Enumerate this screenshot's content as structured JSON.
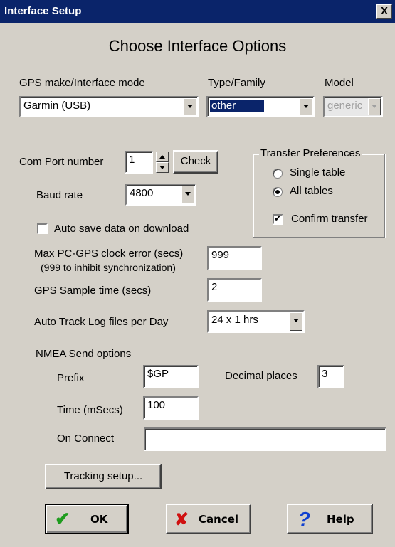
{
  "window": {
    "title": "Interface Setup",
    "close_glyph": "X"
  },
  "heading": "Choose Interface Options",
  "gps_make": {
    "label": "GPS make/Interface mode",
    "value": "Garmin (USB)"
  },
  "type_family": {
    "label": "Type/Family",
    "value": "other"
  },
  "model": {
    "label": "Model",
    "value": "generic"
  },
  "com_port": {
    "label": "Com Port number",
    "value": "1",
    "check_label": "Check"
  },
  "baud": {
    "label": "Baud rate",
    "value": "4800"
  },
  "auto_save": {
    "label": "Auto save data on download",
    "checked": false
  },
  "transfer": {
    "title": "Transfer Preferences",
    "single_label": "Single table",
    "all_label": "All tables",
    "selected": "All tables",
    "confirm_label": "Confirm transfer",
    "confirm_checked": true
  },
  "clock_error": {
    "label1": "Max PC-GPS clock error (secs)",
    "label2": "(999 to inhibit synchronization)",
    "value": "999"
  },
  "sample_time": {
    "label": "GPS Sample time (secs)",
    "value": "2"
  },
  "track_log": {
    "label": "Auto Track Log files per Day",
    "value": "24 x 1 hrs"
  },
  "nmea": {
    "title": "NMEA  Send options",
    "prefix_label": "Prefix",
    "prefix_value": "$GP",
    "decimal_label": "Decimal places",
    "decimal_value": "3",
    "time_label": "Time (mSecs)",
    "time_value": "100",
    "connect_label": "On Connect",
    "connect_value": ""
  },
  "tracking_setup_label": "Tracking setup...",
  "buttons": {
    "ok": "OK",
    "cancel": "Cancel",
    "help_prefix": "",
    "help_u": "H",
    "help_rest": "elp"
  },
  "colors": {
    "titlebar": "#0a246a",
    "dialog": "#d4d0c8",
    "ok_check": "#1e9c1e",
    "cancel_x": "#d01010",
    "help_q": "#1040d0"
  }
}
